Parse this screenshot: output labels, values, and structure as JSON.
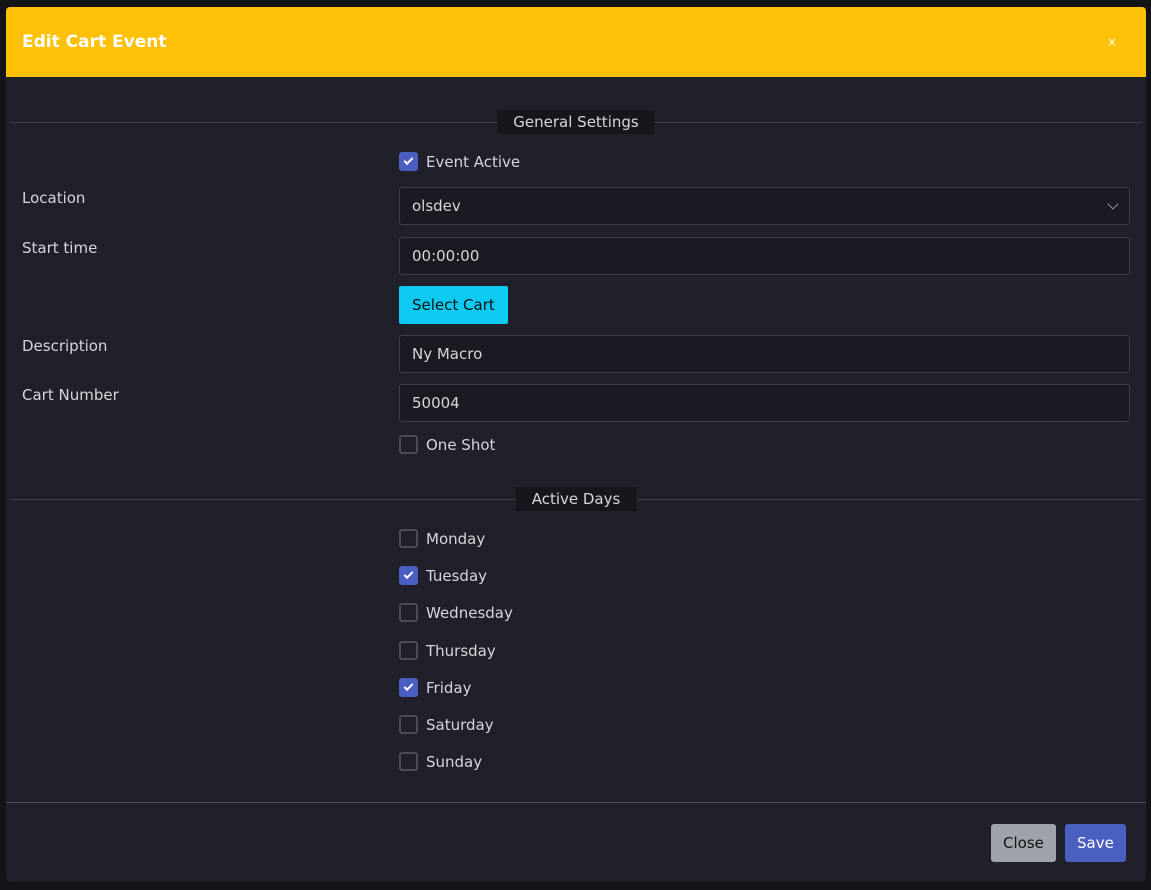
{
  "modal": {
    "title": "Edit Cart Event",
    "close_glyph": "×"
  },
  "sections": {
    "general": "General Settings",
    "days": "Active Days"
  },
  "form": {
    "event_active_label": "Event Active",
    "event_active_checked": true,
    "location_label": "Location",
    "location_value": "olsdev",
    "start_time_label": "Start time",
    "start_time_value": "00:00:00",
    "select_cart_label": "Select Cart",
    "description_label": "Description",
    "description_value": "Ny Macro",
    "cart_number_label": "Cart Number",
    "cart_number_value": "50004",
    "one_shot_label": "One Shot",
    "one_shot_checked": false
  },
  "days": [
    {
      "label": "Monday",
      "checked": false
    },
    {
      "label": "Tuesday",
      "checked": true
    },
    {
      "label": "Wednesday",
      "checked": false
    },
    {
      "label": "Thursday",
      "checked": false
    },
    {
      "label": "Friday",
      "checked": true
    },
    {
      "label": "Saturday",
      "checked": false
    },
    {
      "label": "Sunday",
      "checked": false
    }
  ],
  "footer": {
    "close_label": "Close",
    "save_label": "Save"
  },
  "colors": {
    "header": "#ffc107",
    "primary": "#4a5fc1",
    "info": "#0dcaf0"
  },
  "icons": {
    "chevron": "chevron-down-icon",
    "check": "check-icon"
  }
}
